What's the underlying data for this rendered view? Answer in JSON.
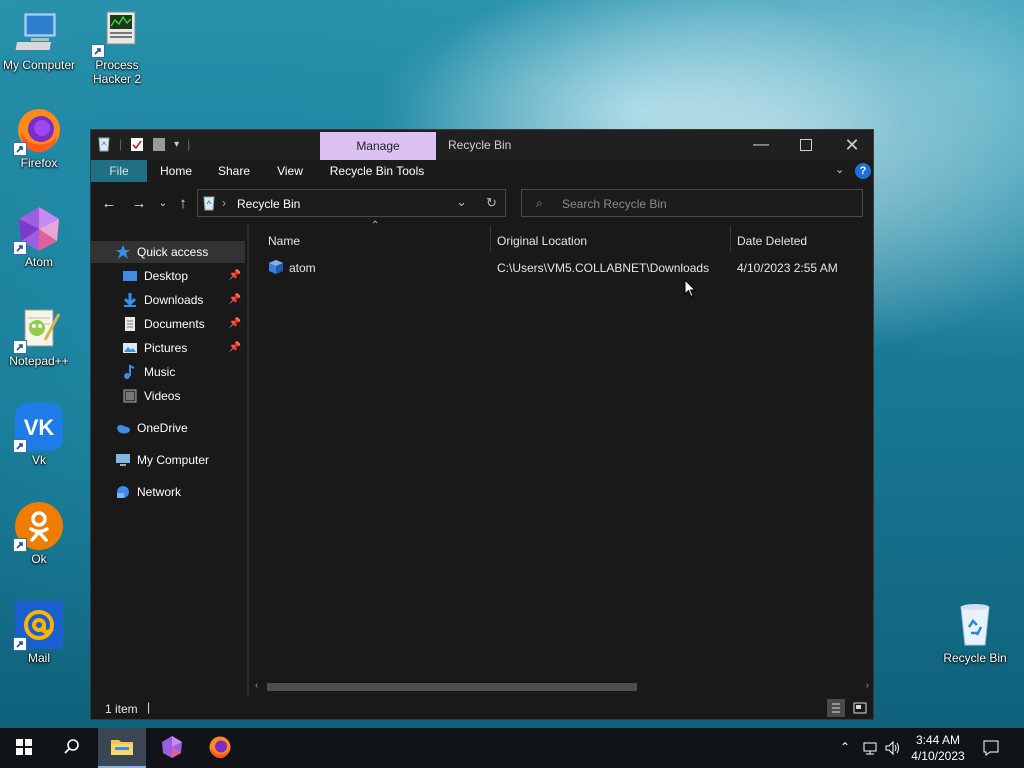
{
  "desktop": {
    "icons": [
      {
        "label": "My Computer",
        "icon": "computer-icon"
      },
      {
        "label": "Process Hacker 2",
        "label_line1": "Process",
        "label_line2": "Hacker 2",
        "icon": "process-hacker-icon"
      },
      {
        "label": "Firefox",
        "icon": "firefox-icon"
      },
      {
        "label": "Atom",
        "icon": "atom-icon"
      },
      {
        "label": "Notepad++",
        "icon": "notepadpp-icon"
      },
      {
        "label": "Vk",
        "icon": "vk-icon"
      },
      {
        "label": "Ok",
        "icon": "ok-icon"
      },
      {
        "label": "Mail",
        "icon": "mail-icon"
      },
      {
        "label": "Recycle Bin",
        "icon": "recycle-bin-icon"
      }
    ]
  },
  "window": {
    "title": "Recycle Bin",
    "manage_tab": "Manage",
    "ribbon_tabs": [
      "File",
      "Home",
      "Share",
      "View",
      "Recycle Bin Tools"
    ],
    "address": {
      "path": "Recycle Bin"
    },
    "search": {
      "placeholder": "Search Recycle Bin"
    },
    "nav_pane": {
      "items": [
        {
          "label": "Quick access",
          "icon": "star-icon",
          "selected": true
        },
        {
          "label": "Desktop",
          "icon": "desktop-folder-icon",
          "pinned": true
        },
        {
          "label": "Downloads",
          "icon": "downloads-icon",
          "pinned": true
        },
        {
          "label": "Documents",
          "icon": "documents-icon",
          "pinned": true
        },
        {
          "label": "Pictures",
          "icon": "pictures-icon",
          "pinned": true
        },
        {
          "label": "Music",
          "icon": "music-icon"
        },
        {
          "label": "Videos",
          "icon": "videos-icon"
        },
        {
          "label": "OneDrive",
          "icon": "onedrive-icon"
        },
        {
          "label": "My Computer",
          "icon": "computer-icon"
        },
        {
          "label": "Network",
          "icon": "network-icon"
        }
      ]
    },
    "columns": [
      "Name",
      "Original Location",
      "Date Deleted"
    ],
    "rows": [
      {
        "name": "atom",
        "location": "C:\\Users\\VM5.COLLABNET\\Downloads",
        "date": "4/10/2023 2:55 AM"
      }
    ],
    "status": {
      "item_count": "1 item"
    }
  },
  "taskbar": {
    "clock_time": "3:44 AM",
    "clock_date": "4/10/2023",
    "accent": "#8ab4e8"
  }
}
